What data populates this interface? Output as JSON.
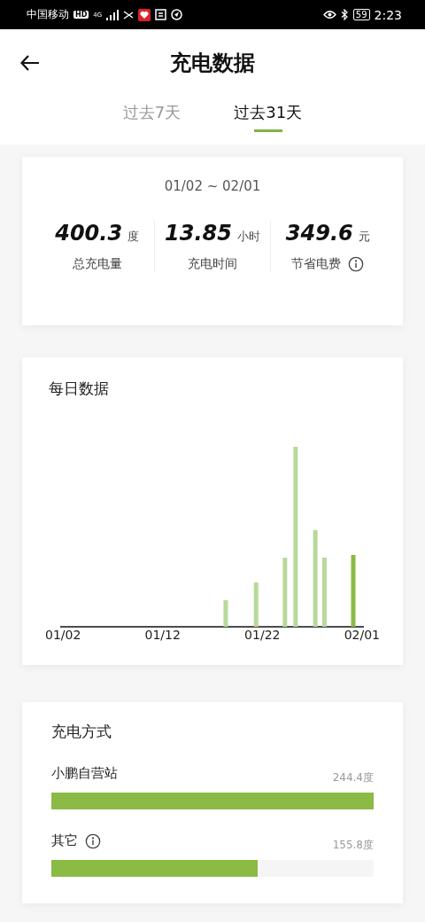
{
  "status_bar": {
    "carrier": "中国移动",
    "hd_badge": "HD",
    "network": "4G",
    "battery": "59",
    "time": "2:23"
  },
  "header": {
    "title": "充电数据"
  },
  "tabs": [
    {
      "label": "过去7天",
      "selected": false
    },
    {
      "label": "过去31天",
      "selected": true
    }
  ],
  "summary": {
    "date_range": "01/02 ~ 02/01",
    "stats": [
      {
        "value": "400.3",
        "unit": "度",
        "label": "总充电量",
        "info": false
      },
      {
        "value": "13.85",
        "unit": "小时",
        "label": "充电时间",
        "info": false
      },
      {
        "value": "349.6",
        "unit": "元",
        "label": "节省电费",
        "info": true
      }
    ]
  },
  "daily": {
    "title": "每日数据",
    "x_labels": [
      "01/02",
      "01/12",
      "01/22",
      "02/01"
    ]
  },
  "methods": {
    "title": "充电方式",
    "items": [
      {
        "name": "小鹏自营站",
        "info": false,
        "amount": "244.4度",
        "level": 1
      },
      {
        "name": "其它",
        "info": true,
        "amount": "155.8度",
        "level": 0.64
      }
    ]
  }
}
